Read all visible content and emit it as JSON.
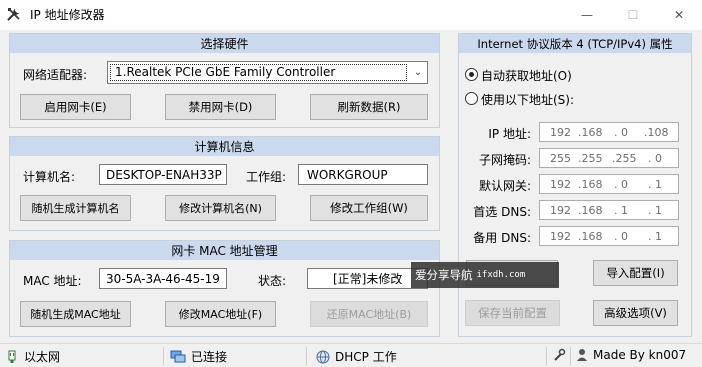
{
  "window": {
    "title": "IP 地址修改器",
    "minimize_glyph": "—",
    "maximize_glyph": "☐",
    "close_glyph": "✕"
  },
  "hardware": {
    "header": "选择硬件",
    "adapter_label": "网络适配器:",
    "adapter_value": "1.Realtek PCIe GbE Family Controller",
    "enable_btn": "启用网卡(E)",
    "disable_btn": "禁用网卡(D)",
    "refresh_btn": "刷新数据(R)"
  },
  "computer": {
    "header": "计算机信息",
    "name_label": "计算机名:",
    "name_value": "DESKTOP-ENAH33P",
    "workgroup_label": "工作组:",
    "workgroup_value": "WORKGROUP",
    "random_name_btn": "随机生成计算机名",
    "change_name_btn": "修改计算机名(N)",
    "change_workgroup_btn": "修改工作组(W)"
  },
  "mac": {
    "header": "网卡 MAC 地址管理",
    "mac_label": "MAC 地址:",
    "mac_value": "30-5A-3A-46-45-19",
    "status_label": "状态:",
    "status_value": "[正常]未修改",
    "random_mac_btn": "随机生成MAC地址",
    "change_mac_btn": "修改MAC地址(F)",
    "restore_mac_btn": "还原MAC地址(B)"
  },
  "tcpip": {
    "header": "Internet 协议版本 4 (TCP/IPv4) 属性",
    "auto_radio": "自动获取地址(O)",
    "manual_radio": "使用以下地址(S):",
    "fields": [
      {
        "label": "IP 地址:",
        "octets": [
          "192",
          ".168",
          ". 0",
          ".108"
        ]
      },
      {
        "label": "子网掩码:",
        "octets": [
          "255",
          ".255",
          ".255",
          ". 0"
        ]
      },
      {
        "label": "默认网关:",
        "octets": [
          "192",
          ".168",
          ". 0",
          ". 1"
        ]
      },
      {
        "label": "首选 DNS:",
        "octets": [
          "192",
          ".168",
          ". 1",
          ". 1"
        ]
      },
      {
        "label": "备用 DNS:",
        "octets": [
          "192",
          ".168",
          ". 0",
          ". 1"
        ]
      }
    ],
    "import_btn": "导入配置(I)",
    "save_btn": "保存当前配置",
    "advanced_btn": "高级选项(V)"
  },
  "watermark": {
    "text": "爱分享导航",
    "url": "ifxdh.com"
  },
  "statusbar": {
    "connection_type": "以太网",
    "connection_state": "已连接",
    "dhcp_state": "DHCP 工作",
    "credit": "Made By kn007"
  }
}
